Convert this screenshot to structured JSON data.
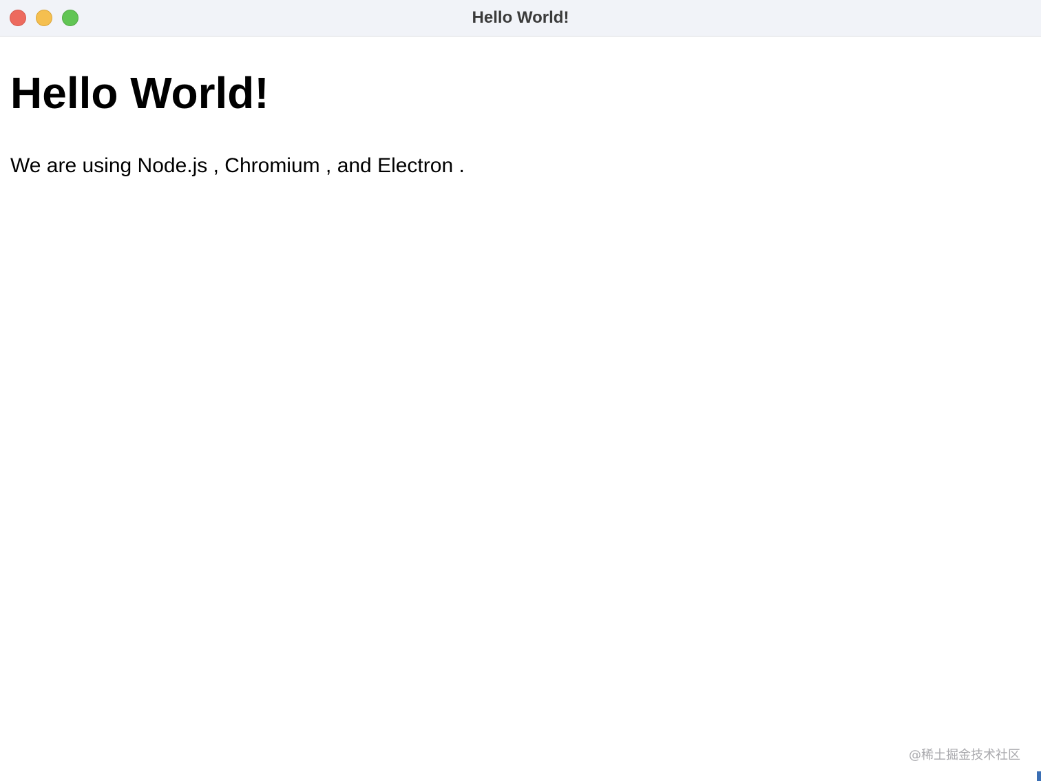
{
  "window": {
    "title": "Hello World!"
  },
  "page": {
    "heading": "Hello World!",
    "paragraph": {
      "prefix": "We are using Node.js",
      "sep1": ",",
      "chromium": "Chromium",
      "sep2": ",",
      "and_label": "and Electron",
      "end": "."
    }
  },
  "watermark": {
    "text": "@稀土掘金技术社区"
  },
  "colors": {
    "titlebar": "#f1f3f8",
    "close": "#ed6a5e",
    "minimize": "#f5bf4f",
    "zoom": "#61c554",
    "text": "#000000",
    "watermark": "#a9a9ad"
  }
}
